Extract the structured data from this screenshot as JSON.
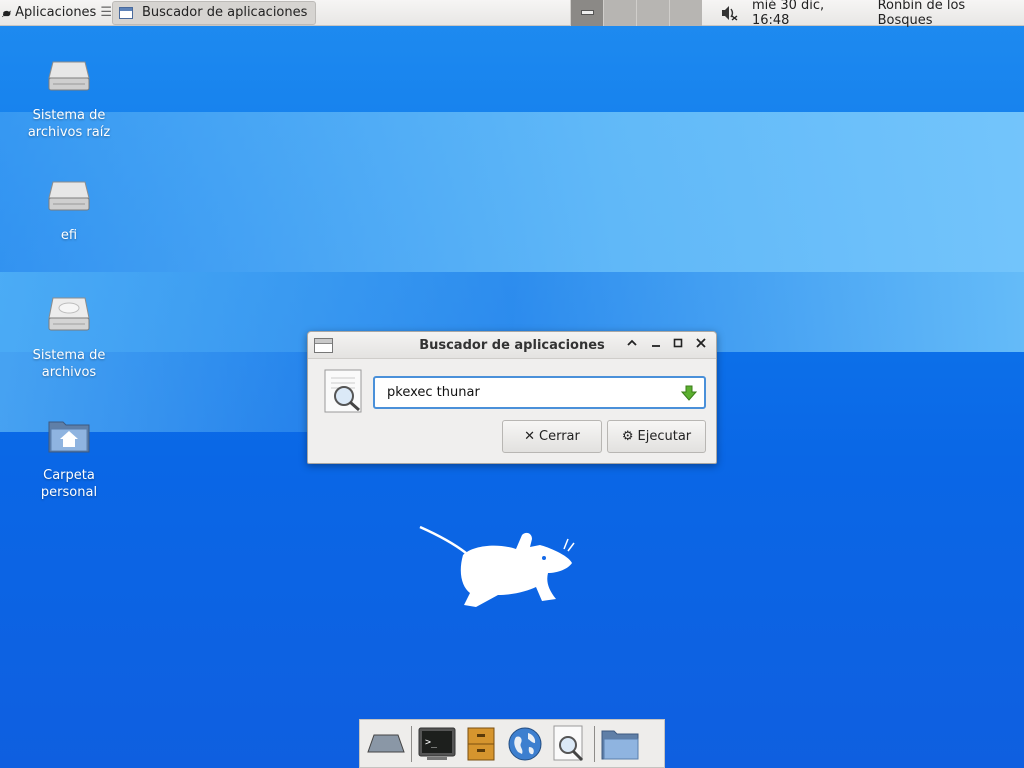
{
  "panel": {
    "apps_menu_label": "Aplicaciones",
    "task_button_label": "Buscador de aplicaciones",
    "clock": "mié 30 dic, 16:48",
    "user": "Ronbin de los Bosques"
  },
  "desktop": {
    "icons": [
      {
        "label": "Sistema de archivos raíz",
        "icon": "drive-icon"
      },
      {
        "label": "efi",
        "icon": "drive-icon"
      },
      {
        "label": "Sistema de archivos",
        "icon": "drive-icon"
      },
      {
        "label": "Carpeta personal",
        "icon": "home-folder-icon"
      }
    ]
  },
  "dialog": {
    "title": "Buscador de aplicaciones",
    "command_value": "pkexec thunar",
    "close_label": "Cerrar",
    "run_label": "Ejecutar"
  },
  "dock": {
    "items": [
      "show-desktop-icon",
      "terminal-icon",
      "file-cabinet-icon",
      "web-browser-icon",
      "app-finder-icon",
      "folder-icon"
    ]
  },
  "colors": {
    "accent": "#4a90d9",
    "wallpaper": "#0a67e6"
  }
}
